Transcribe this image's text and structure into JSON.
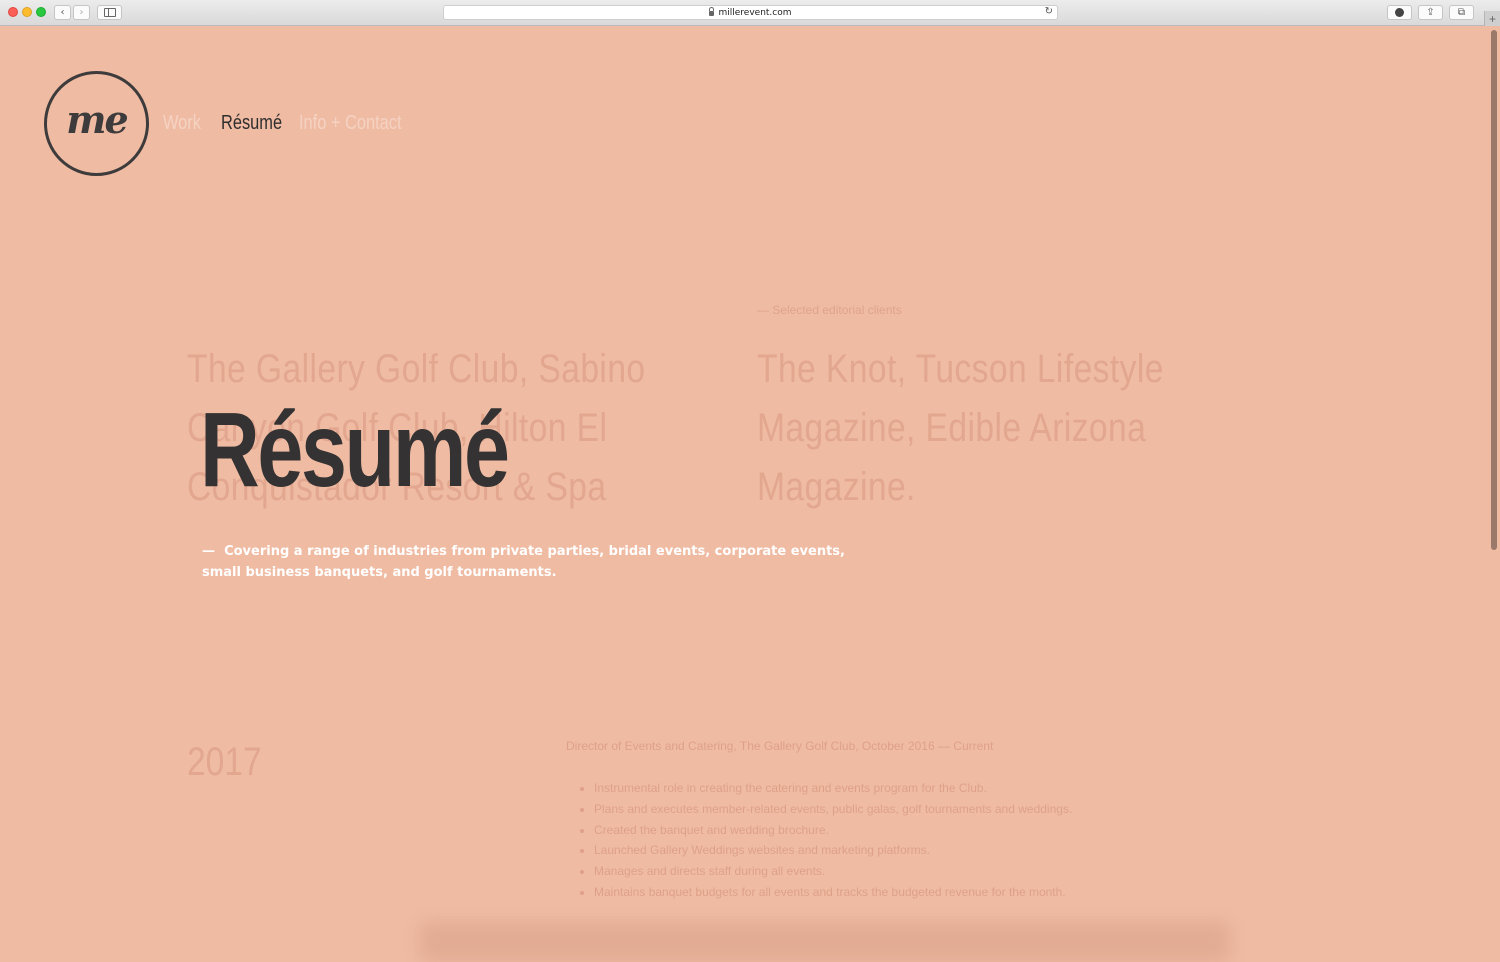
{
  "browser": {
    "url": "millerevent.com"
  },
  "site": {
    "logo_text": "me",
    "nav": {
      "work": "Work",
      "resume": "Résumé",
      "info": "Info + Contact"
    }
  },
  "hero": {
    "title": "Résumé",
    "dash": "—",
    "subtitle": "Covering a range of industries from private parties, bridal events, corporate events, small business banquets, and golf tournaments."
  },
  "background": {
    "left_big": "The Gallery Golf Club, Sabino Canyon Golf Club, Hilton El Conquistador Resort & Spa",
    "right_label": "— Selected editorial clients",
    "right_big": "The Knot, Tucson Lifestyle Magazine, Edible Arizona Magazine.",
    "year": "2017",
    "job_title": "Director of Events and Catering, The Gallery Golf Club, October 2016 — Current",
    "bullets": [
      "Instrumental role in creating the catering and events program for the Club.",
      "Plans and executes member-related events, public galas, golf tournaments and weddings.",
      "Created the banquet and wedding brochure.",
      "Launched Gallery Weddings websites and marketing platforms.",
      "Manages and directs staff during all events.",
      "Maintains banquet budgets for all events and tracks the budgeted revenue for the month."
    ]
  },
  "colors": {
    "page_bg": "#efbba3",
    "text_dark": "#343232",
    "nav_inactive": "#f5d3c3",
    "subtitle": "#ffffff"
  }
}
